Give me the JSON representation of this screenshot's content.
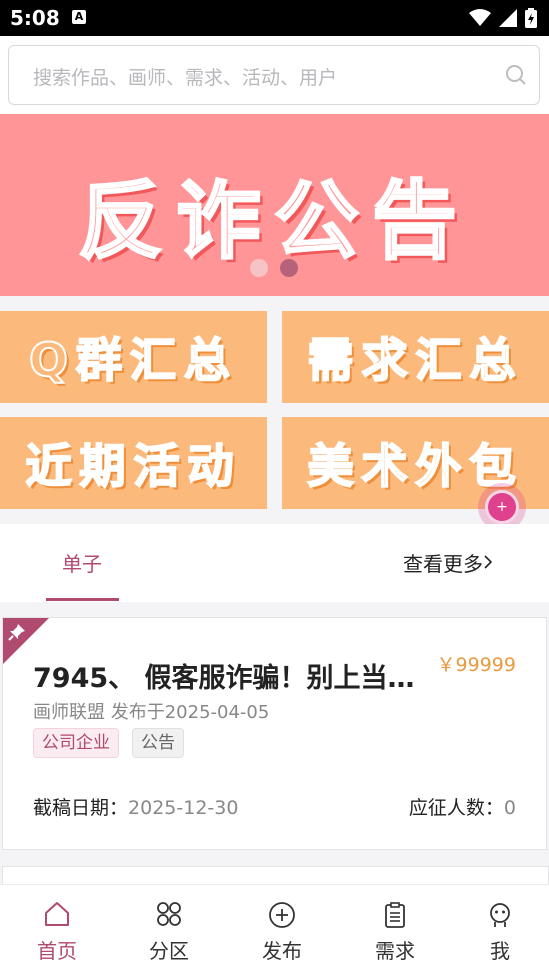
{
  "status_bar": {
    "time": "5:08",
    "indicator": "A"
  },
  "search": {
    "placeholder": "搜索作品、画师、需求、活动、用户"
  },
  "banner": {
    "title": "反诈公告",
    "slide_count": 2,
    "active_slide": 2
  },
  "tiles": [
    {
      "label": "Q群汇总"
    },
    {
      "label": "需求汇总"
    },
    {
      "label": "近期活动"
    },
    {
      "label": "美术外包"
    }
  ],
  "tabs": {
    "active": "单子",
    "see_more": "查看更多"
  },
  "card": {
    "title": "7945、 假客服诈骗！别上当…",
    "price": "￥99999",
    "meta": "画师联盟 发布于2025-04-05",
    "tags": [
      "公司企业",
      "公告"
    ],
    "deadline_label": "截稿日期：",
    "deadline_value": "2025-12-30",
    "applicants_label": "应征人数：",
    "applicants_value": "0"
  },
  "nav": [
    {
      "label": "首页",
      "icon": "home-icon",
      "active": true
    },
    {
      "label": "分区",
      "icon": "grid-icon",
      "active": false
    },
    {
      "label": "发布",
      "icon": "plus-circle-icon",
      "active": false
    },
    {
      "label": "需求",
      "icon": "clipboard-icon",
      "active": false
    },
    {
      "label": "我",
      "icon": "profile-icon",
      "active": false
    }
  ],
  "colors": {
    "accent": "#b04a6f",
    "banner_bg": "#ff9597",
    "tile_bg": "#fbb97c",
    "price": "#e89a3c"
  }
}
